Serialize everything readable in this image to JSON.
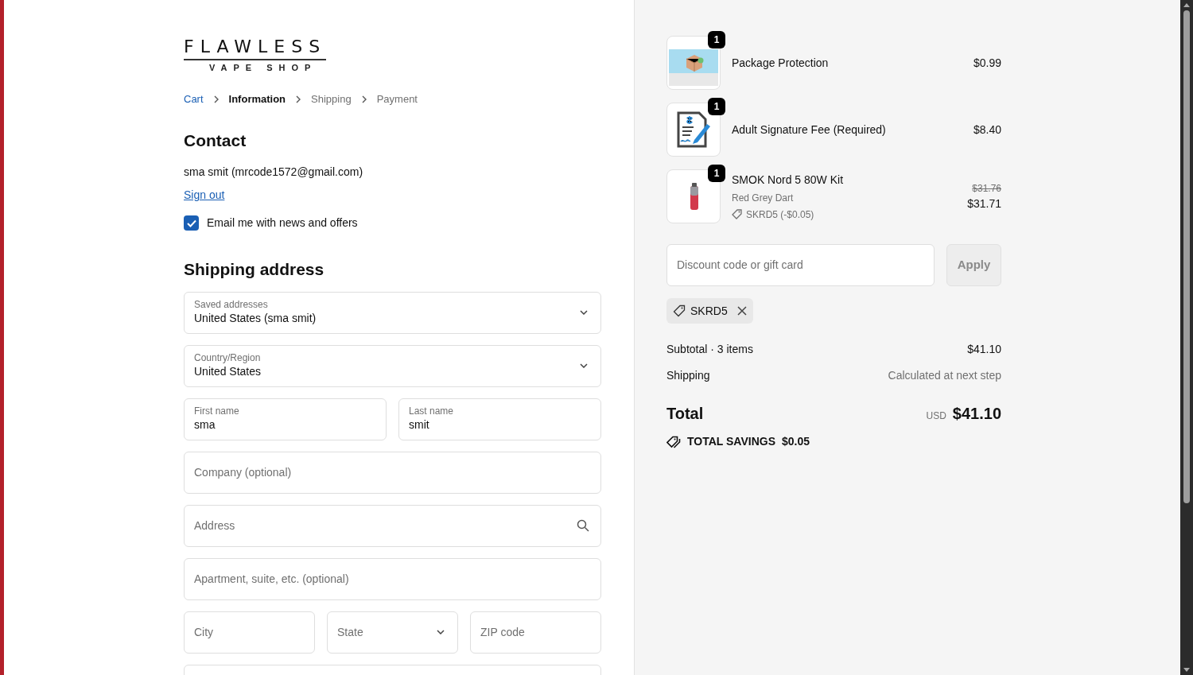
{
  "logo": {
    "title": "FLAWLESS",
    "subtitle": "VAPE SHOP"
  },
  "breadcrumb": [
    {
      "label": "Cart",
      "kind": "link",
      "selected": false
    },
    {
      "label": "Information",
      "kind": "step",
      "selected": true
    },
    {
      "label": "Shipping",
      "kind": "step",
      "selected": false
    },
    {
      "label": "Payment",
      "kind": "step",
      "selected": false
    }
  ],
  "contact": {
    "heading": "Contact",
    "account": "sma smit (mrcode1572@gmail.com)",
    "sign_out": "Sign out",
    "newsletter": {
      "label": "Email me with news and offers",
      "checked": true
    }
  },
  "shipping_address": {
    "heading": "Shipping address",
    "rows": [
      [
        {
          "kind": "select",
          "label": "Saved addresses",
          "value": "United States (sma smit)"
        }
      ],
      [
        {
          "kind": "select",
          "label": "Country/Region",
          "value": "United States"
        }
      ],
      [
        {
          "kind": "input",
          "label": "First name",
          "value": "sma"
        },
        {
          "kind": "input",
          "label": "Last name",
          "value": "smit"
        }
      ],
      [
        {
          "kind": "input",
          "placeholder": "Company (optional)"
        }
      ],
      [
        {
          "kind": "search",
          "placeholder": "Address"
        }
      ],
      [
        {
          "kind": "input",
          "placeholder": "Apartment, suite, etc. (optional)"
        }
      ],
      [
        {
          "kind": "input",
          "placeholder": "City"
        },
        {
          "kind": "select",
          "placeholder": "State"
        },
        {
          "kind": "input",
          "placeholder": "ZIP code"
        }
      ],
      [
        {
          "kind": "input"
        }
      ]
    ]
  },
  "order_summary": {
    "items": [
      {
        "quantity": "1",
        "name": "Package Protection",
        "price": "$0.99"
      },
      {
        "quantity": "1",
        "name": "Adult Signature Fee (Required)",
        "price": "$8.40"
      },
      {
        "quantity": "1",
        "name": "SMOK Nord 5 80W Kit",
        "variant": "Red Grey Dart",
        "discount": "SKRD5 (-$0.05)",
        "original_price": "$31.76",
        "price": "$31.71"
      }
    ],
    "discount_field": {
      "placeholder": "Discount code or gift card"
    },
    "apply_button": {
      "label": "Apply",
      "disabled": true
    },
    "applied_code": "SKRD5",
    "subtotal": {
      "label": "Subtotal · 3 items",
      "value": "$41.10"
    },
    "shipping": {
      "label": "Shipping",
      "value": "Calculated at next step"
    },
    "total": {
      "label": "Total",
      "currency": "USD",
      "value": "$41.10"
    },
    "savings": {
      "label": "TOTAL SAVINGS",
      "value": "$0.05"
    }
  }
}
